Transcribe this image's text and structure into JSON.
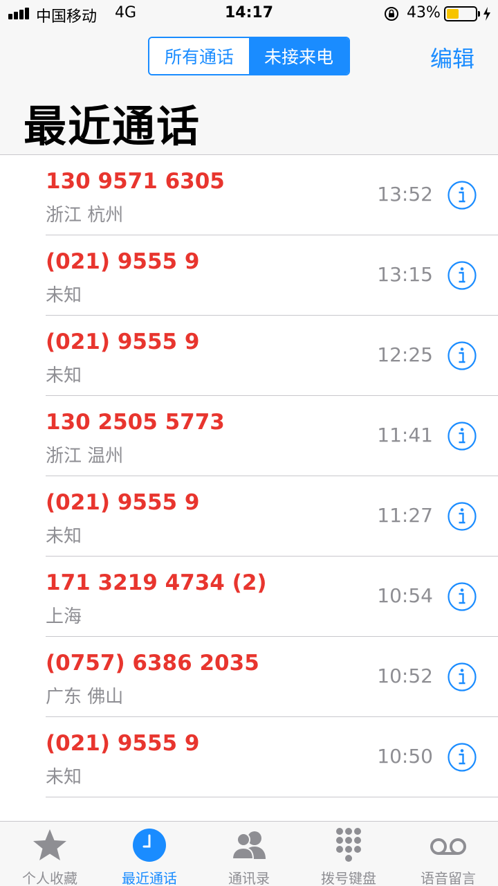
{
  "status_bar": {
    "carrier": "中国移动",
    "network": "4G",
    "time": "14:17",
    "battery_percent": "43%",
    "battery_level": 0.43,
    "battery_color": "#f7c400"
  },
  "header": {
    "segments": [
      "所有通话",
      "未接来电"
    ],
    "active_segment": "未接来电",
    "edit_label": "编辑",
    "title": "最近通话"
  },
  "calls": [
    {
      "number": "130 9571 6305",
      "location": "浙江 杭州",
      "time": "13:52"
    },
    {
      "number": "(021) 9555 9",
      "location": "未知",
      "time": "13:15"
    },
    {
      "number": "(021) 9555 9",
      "location": "未知",
      "time": "12:25"
    },
    {
      "number": "130 2505 5773",
      "location": "浙江 温州",
      "time": "11:41"
    },
    {
      "number": "(021) 9555 9",
      "location": "未知",
      "time": "11:27"
    },
    {
      "number": "171 3219 4734 (2)",
      "location": "上海",
      "time": "10:54"
    },
    {
      "number": "(0757) 6386 2035",
      "location": "广东 佛山",
      "time": "10:52"
    },
    {
      "number": "(021) 9555 9",
      "location": "未知",
      "time": "10:50"
    }
  ],
  "tabs": [
    {
      "label": "个人收藏",
      "icon": "star-icon"
    },
    {
      "label": "最近通话",
      "icon": "clock-icon",
      "active": true
    },
    {
      "label": "通讯录",
      "icon": "contacts-icon"
    },
    {
      "label": "拨号键盘",
      "icon": "keypad-icon"
    },
    {
      "label": "语音留言",
      "icon": "voicemail-icon"
    }
  ],
  "colors": {
    "accent": "#1a8cff",
    "missed_call": "#e8352e",
    "secondary_text": "#8e8e93"
  }
}
